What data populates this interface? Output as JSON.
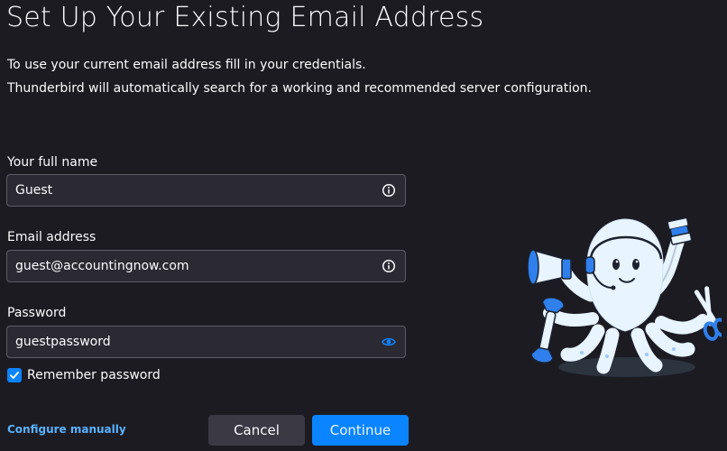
{
  "title": "Set Up Your Existing Email Address",
  "description": {
    "line1": "To use your current email address fill in your credentials.",
    "line2": "Thunderbird will automatically search for a working and recommended server configuration."
  },
  "form": {
    "full_name": {
      "label": "Your full name",
      "value": "Guest",
      "icon": "info-icon"
    },
    "email": {
      "label": "Email address",
      "value": "guest@accountingnow.com",
      "icon": "info-icon"
    },
    "password": {
      "label": "Password",
      "value": "guestpassword",
      "icon": "eye-icon"
    },
    "remember": {
      "label": "Remember password",
      "checked": true
    }
  },
  "footer": {
    "configure_manually": "Configure manually",
    "cancel": "Cancel",
    "continue": "Continue"
  },
  "colors": {
    "background": "#1c1b22",
    "field_background": "#2b2a33",
    "accent": "#0a84ff",
    "link": "#5ab2ff",
    "mascot_body": "#e8f4ff"
  }
}
